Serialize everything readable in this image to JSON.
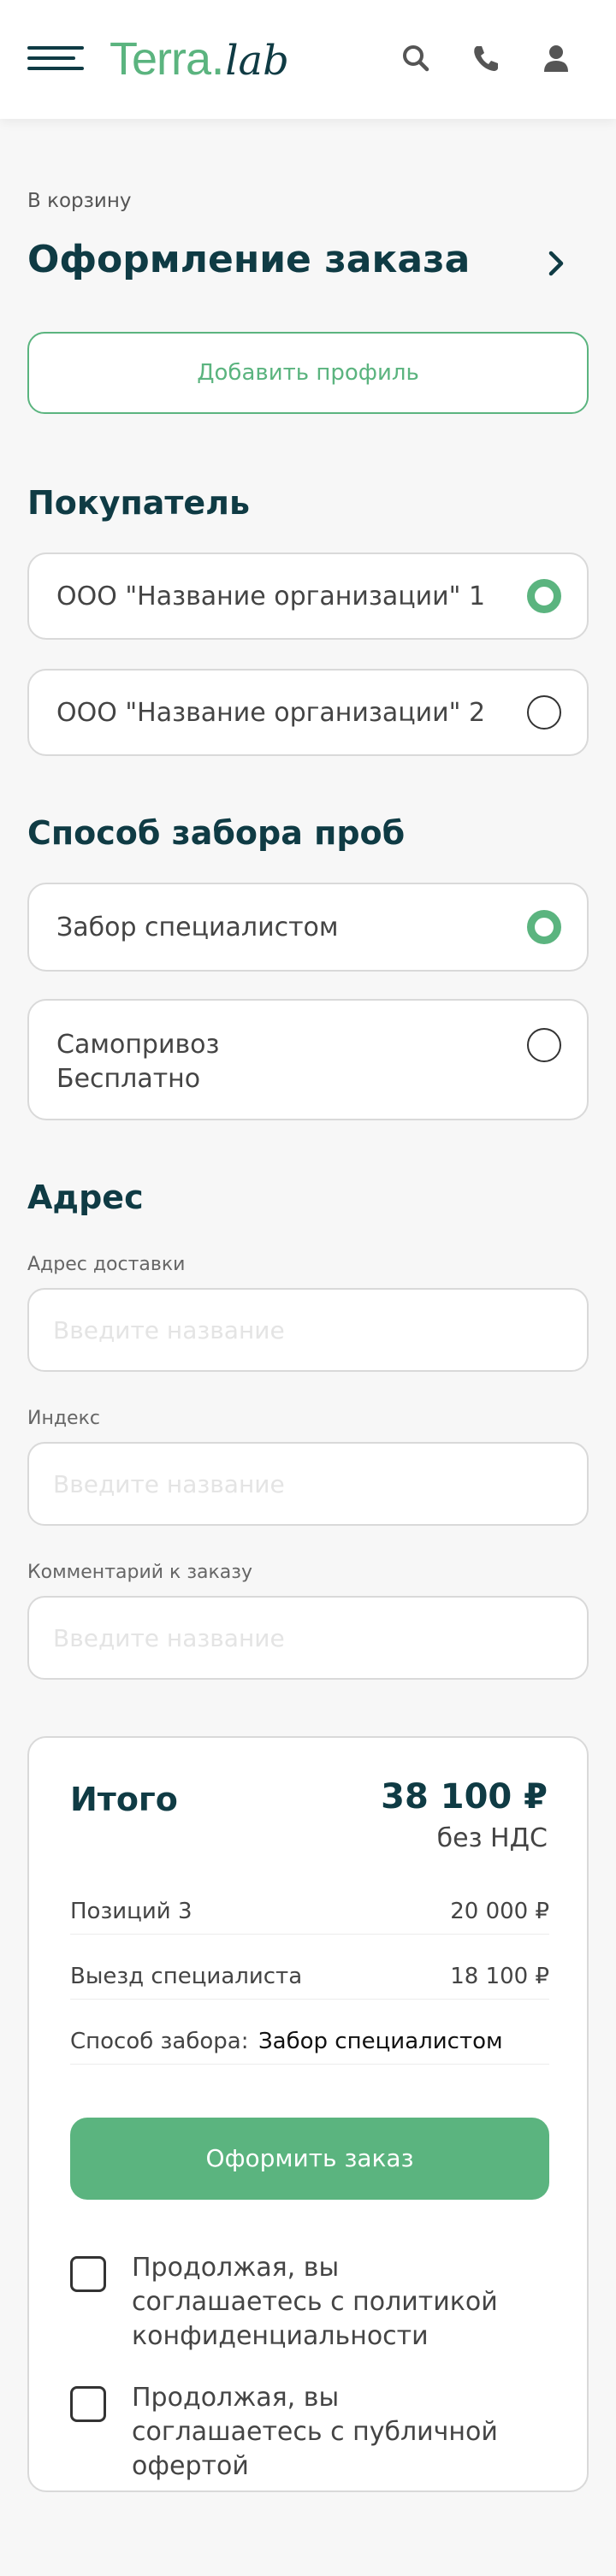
{
  "header": {
    "logo_main": "Terra",
    "logo_dot": ".",
    "logo_sub": "lab",
    "icons": [
      "menu-icon",
      "search-icon",
      "phone-icon",
      "user-icon"
    ]
  },
  "breadcrumb": "В корзину",
  "page_title": "Оформление заказа",
  "add_profile_label": "Добавить профиль",
  "buyer": {
    "heading": "Покупатель",
    "options": [
      {
        "label": "ООО \"Название организации\" 1",
        "selected": true
      },
      {
        "label": "ООО \"Название организации\" 2",
        "selected": false
      }
    ]
  },
  "sampling": {
    "heading": "Способ забора проб",
    "options": [
      {
        "label": "Забор специалистом",
        "selected": true
      },
      {
        "label": "Самопривоз",
        "sublabel": "Бесплатно",
        "selected": false
      }
    ]
  },
  "address": {
    "heading": "Адрес",
    "fields": [
      {
        "label": "Адрес доставки",
        "placeholder": "Введите название",
        "value": ""
      },
      {
        "label": "Индекс",
        "placeholder": "Введите название",
        "value": ""
      },
      {
        "label": "Комментарий к заказу",
        "placeholder": "Введите название",
        "value": ""
      }
    ]
  },
  "summary": {
    "title": "Итого",
    "total": "38 100 ₽",
    "vat_note": "без НДС",
    "rows": [
      {
        "label": "Позиций 3",
        "value": "20 000 ₽"
      },
      {
        "label": "Выезд специалиста",
        "value": "18 100 ₽"
      },
      {
        "label": "Способ забора:",
        "value": "Забор специалистом"
      }
    ],
    "submit_label": "Оформить заказ",
    "agreements": [
      {
        "text": "Продолжая, вы соглашаетесь с политикой конфиденциальности",
        "checked": false
      },
      {
        "text": "Продолжая, вы соглашаетесь с публичной офертой",
        "checked": false
      }
    ]
  },
  "colors": {
    "accent": "#5bb47f",
    "heading": "#0f3b44",
    "border": "#d9d9d9",
    "background": "#f7f7f7"
  }
}
